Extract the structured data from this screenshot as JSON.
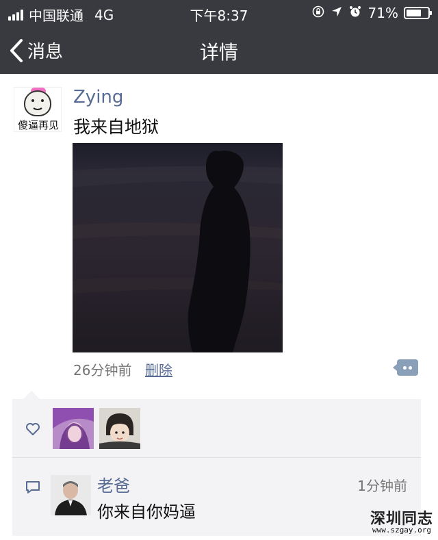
{
  "status_bar": {
    "carrier": "中国联通",
    "network": "4G",
    "time": "下午8:37",
    "battery_percent": "71%",
    "battery_level": 0.71
  },
  "nav": {
    "back_label": "消息",
    "title": "详情"
  },
  "post": {
    "author_avatar_caption": "傻逼再见",
    "author": "Zying",
    "text": "我来自地狱",
    "time_ago": "26分钟前",
    "delete_label": "删除"
  },
  "comments": [
    {
      "name": "老爸",
      "time": "1分钟前",
      "text": "你来自你妈逼"
    }
  ],
  "watermark": {
    "title": "深圳同志",
    "url": "www.szgay.org"
  },
  "colors": {
    "header_bg": "#393a3f",
    "link_blue": "#576b95",
    "panel_bg": "#f3f3f5"
  },
  "icons": [
    "back-chevron-icon",
    "lock-rotation-icon",
    "location-arrow-icon",
    "alarm-clock-icon",
    "battery-icon",
    "heart-icon",
    "comment-bubble-icon",
    "more-actions-icon"
  ]
}
